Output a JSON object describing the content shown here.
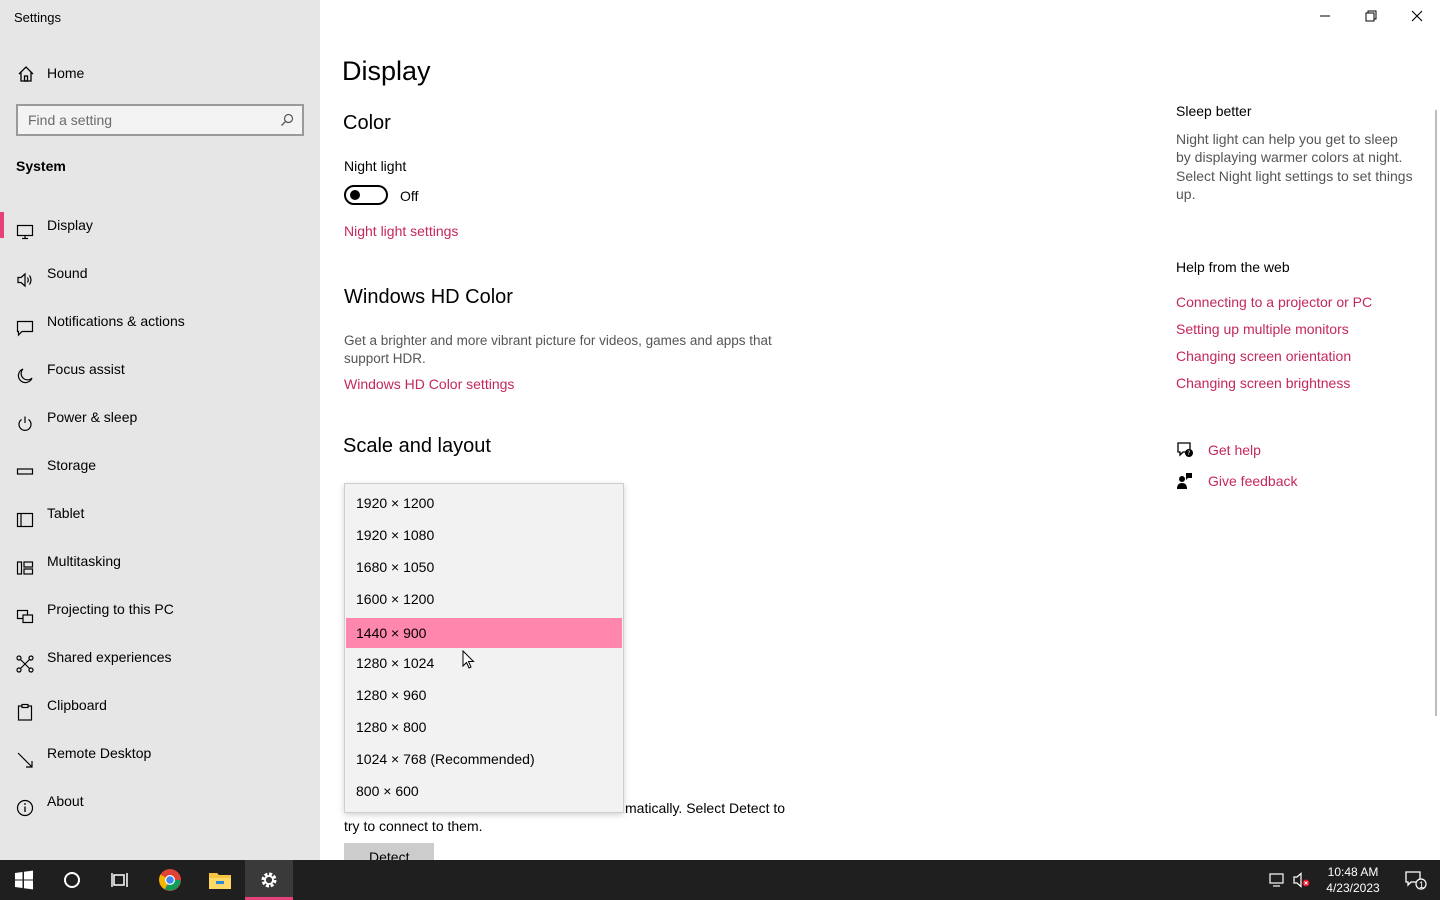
{
  "app": {
    "title": "Settings"
  },
  "sidebar": {
    "home_label": "Home",
    "search_placeholder": "Find a setting",
    "section": "System",
    "items": [
      {
        "label": "Display",
        "icon": "monitor-icon"
      },
      {
        "label": "Sound",
        "icon": "speaker-icon"
      },
      {
        "label": "Notifications & actions",
        "icon": "notification-icon"
      },
      {
        "label": "Focus assist",
        "icon": "moon-icon"
      },
      {
        "label": "Power & sleep",
        "icon": "power-icon"
      },
      {
        "label": "Storage",
        "icon": "storage-icon"
      },
      {
        "label": "Tablet",
        "icon": "tablet-icon"
      },
      {
        "label": "Multitasking",
        "icon": "multitasking-icon"
      },
      {
        "label": "Projecting to this PC",
        "icon": "projecting-icon"
      },
      {
        "label": "Shared experiences",
        "icon": "share-icon"
      },
      {
        "label": "Clipboard",
        "icon": "clipboard-icon"
      },
      {
        "label": "Remote Desktop",
        "icon": "remote-desktop-icon"
      },
      {
        "label": "About",
        "icon": "info-icon"
      }
    ]
  },
  "main": {
    "title": "Display",
    "color": {
      "heading": "Color",
      "night_light_label": "Night light",
      "toggle_state": "Off",
      "night_light_settings_link": "Night light settings"
    },
    "hdr": {
      "heading": "Windows HD Color",
      "desc_line1": "Get a brighter and more vibrant picture for videos, games and apps that",
      "desc_line2": "support HDR.",
      "link": "Windows HD Color settings"
    },
    "scale": {
      "heading": "Scale and layout",
      "resolution_options": [
        "1920 × 1200",
        "1920 × 1080",
        "1680 × 1050",
        "1600 × 1200",
        "1440 × 900",
        "1280 × 1024",
        "1280 × 960",
        "1280 × 800",
        "1024 × 768 (Recommended)",
        "800 × 600"
      ],
      "selected_option": "1440 × 900"
    },
    "detect": {
      "text_line1_visible": "matically. Select Detect to",
      "text_line2": "try to connect to them.",
      "button_label": "Detect"
    }
  },
  "right": {
    "sleep_heading": "Sleep better",
    "sleep_lines": [
      "Night light can help you get to sleep",
      "by displaying warmer colors at night.",
      "Select Night light settings to set things",
      "up."
    ],
    "help_heading": "Help from the web",
    "help_links": [
      "Connecting to a projector or PC",
      "Setting up multiple monitors",
      "Changing screen orientation",
      "Changing screen brightness"
    ],
    "get_help": "Get help",
    "give_feedback": "Give feedback"
  },
  "taskbar": {
    "time": "10:48 AM",
    "date": "4/23/2023",
    "notification_count": "1"
  },
  "colors": {
    "accent": "#c4285a",
    "selection": "#ff86ad",
    "sidebar_bg": "#e6e6e6",
    "taskbar_bg": "#1f1f1f"
  }
}
